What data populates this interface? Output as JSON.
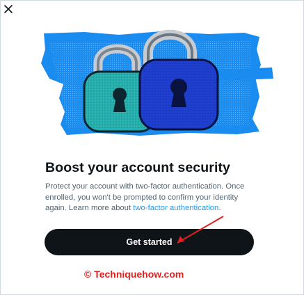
{
  "dialog": {
    "close_icon": "close-icon",
    "illustration_icon": "padlocks-illustration",
    "title": "Boost your account security",
    "description": "Protect your account with two-factor authentication. Once enrolled, you won't be prompted to confirm your identity again. Learn more about ",
    "description_link": "two-factor authentication",
    "description_end": ".",
    "cta_label": "Get started"
  },
  "watermark": {
    "text": "© Techniquehow.com"
  },
  "colors": {
    "title": "#0f1419",
    "body_text": "#536471",
    "link": "#1d9bf0",
    "button_bg": "#0f1419",
    "button_text": "#ffffff",
    "annotation": "#e0201f",
    "hero_blue": "#1a8cf0",
    "lock_teal": "#29b3b0",
    "lock_blue": "#1e3fd0"
  }
}
